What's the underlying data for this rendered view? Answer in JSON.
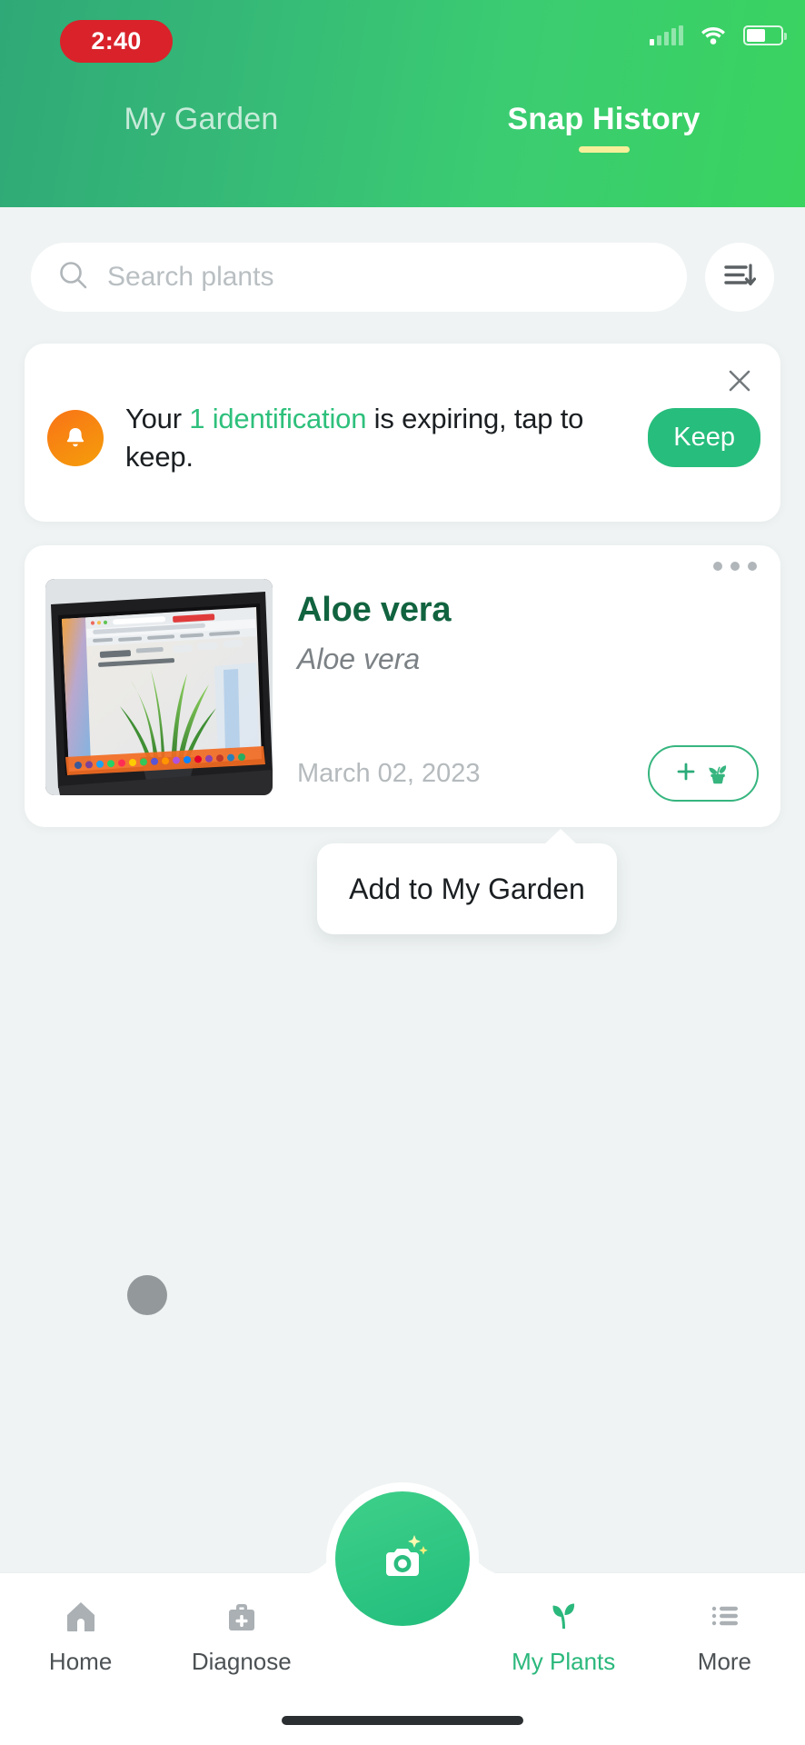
{
  "status_bar": {
    "time": "2:40",
    "signal_icon": "cellular-signal-icon",
    "wifi_icon": "wifi-icon",
    "battery_icon": "battery-icon"
  },
  "header": {
    "gradient_from": "#2fa977",
    "gradient_to": "#3ad35f",
    "underline_color": "#f7f09a",
    "tabs": [
      {
        "label": "My Garden",
        "active": false
      },
      {
        "label": "Snap History",
        "active": true
      }
    ]
  },
  "search": {
    "placeholder": "Search plants",
    "value": "",
    "search_icon": "search-icon",
    "sort_icon": "sort-descending-icon"
  },
  "notice": {
    "prefix": "Your ",
    "highlight": "1 identification",
    "suffix": " is expiring, tap to keep.",
    "highlight_color": "#2ec07c",
    "keep_label": "Keep",
    "keep_color": "#27bd7d",
    "bell_icon": "bell-icon",
    "close_icon": "close-icon"
  },
  "plant_card": {
    "name": "Aloe vera",
    "latin_name": "Aloe vera",
    "date": "March 02, 2023",
    "name_color": "#11633f",
    "menu_icon": "more-options-icon",
    "thumbnail_alt": "laptop-screen-showing-aloe-vera-plant",
    "add_button": {
      "plus_icon": "plus-icon",
      "plant_icon": "potted-plant-icon",
      "border_color": "#36b57f"
    }
  },
  "tooltip": {
    "text": "Add to My Garden"
  },
  "bottom_nav": {
    "active_color": "#2bb87c",
    "items": [
      {
        "label": "Home",
        "icon": "home-icon",
        "active": false
      },
      {
        "label": "Diagnose",
        "icon": "first-aid-kit-icon",
        "active": false
      },
      {
        "label": "My Plants",
        "icon": "seedling-icon",
        "active": true
      },
      {
        "label": "More",
        "icon": "list-menu-icon",
        "active": false
      }
    ],
    "camera_button": {
      "icon": "camera-icon",
      "sparkle_icon": "sparkle-icon"
    }
  }
}
